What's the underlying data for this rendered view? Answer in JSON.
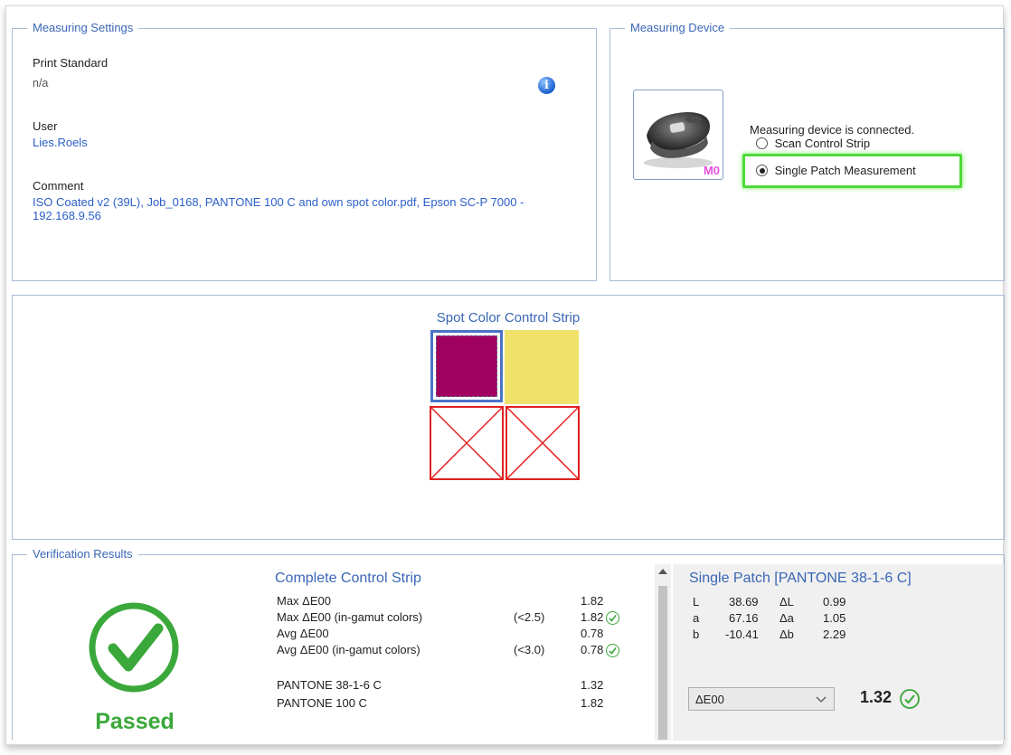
{
  "measuring_settings": {
    "legend": "Measuring Settings",
    "print_standard_label": "Print Standard",
    "print_standard_value": "n/a",
    "user_label": "User",
    "user_value": "Lies.Roels",
    "comment_label": "Comment",
    "comment_value": "ISO Coated v2 (39L), Job_0168, PANTONE 100 C and own spot color.pdf, Epson SC-P 7000 - 192.168.9.56",
    "info_icon_glyph": "i"
  },
  "measuring_device": {
    "legend": "Measuring Device",
    "status": "Measuring device is connected.",
    "device_badge": "M0",
    "options": [
      {
        "label": "Scan Control Strip",
        "selected": false
      },
      {
        "label": "Single Patch Measurement",
        "selected": true
      }
    ]
  },
  "control_strip": {
    "title": "Spot Color Control Strip",
    "patch_colors": [
      "#a0005e",
      "#f0e16a"
    ]
  },
  "verification": {
    "legend": "Verification Results",
    "status": "Passed",
    "complete_title": "Complete Control Strip",
    "rows": [
      {
        "label": "Max ΔE00",
        "limit": "",
        "value": "1.82",
        "ok": false
      },
      {
        "label": "Max ΔE00 (in-gamut colors)",
        "limit": "(<2.5)",
        "value": "1.82",
        "ok": true
      },
      {
        "label": "Avg ΔE00",
        "limit": "",
        "value": "0.78",
        "ok": false
      },
      {
        "label": "Avg ΔE00 (in-gamut colors)",
        "limit": "(<3.0)",
        "value": "0.78",
        "ok": true
      }
    ],
    "patch_rows": [
      {
        "label": "PANTONE 38-1-6 C",
        "value": "1.32"
      },
      {
        "label": "PANTONE 100 C",
        "value": "1.82"
      }
    ],
    "single_title": "Single Patch [PANTONE 38-1-6 C]",
    "lab": [
      {
        "k": "L",
        "v": "38.69",
        "dk": "ΔL",
        "dv": "0.99"
      },
      {
        "k": "a",
        "v": "67.16",
        "dk": "Δa",
        "dv": "1.05"
      },
      {
        "k": "b",
        "v": "-10.41",
        "dk": "Δb",
        "dv": "2.29"
      }
    ],
    "metric_select": "ΔE00",
    "metric_value": "1.32"
  },
  "colors": {
    "accent_blue": "#3a66b5",
    "pass_green": "#3aa83a",
    "highlight_green": "#4fd93a",
    "error_red": "#e02020"
  }
}
